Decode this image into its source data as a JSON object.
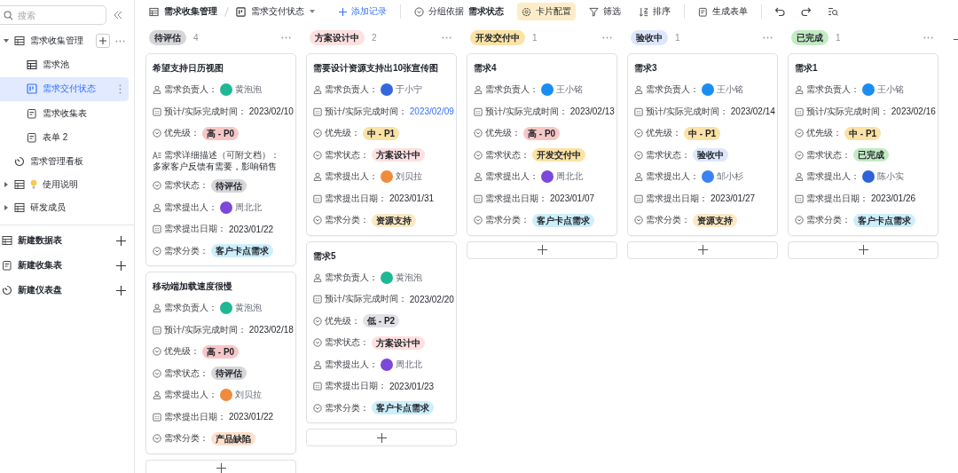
{
  "sidebar": {
    "search": {
      "placeholder": "搜索"
    },
    "tree": [
      {
        "label": "需求收集管理",
        "kind": "table",
        "expanded": true,
        "selected": false,
        "children": [
          {
            "label": "需求池",
            "kind": "grid",
            "selected": false
          },
          {
            "label": "需求交付状态",
            "kind": "kanban",
            "selected": true
          },
          {
            "label": "需求收集表",
            "kind": "form",
            "selected": false
          },
          {
            "label": "表单 2",
            "kind": "form",
            "selected": false
          }
        ]
      },
      {
        "label": "需求管理看板",
        "kind": "dashboard",
        "selected": false
      },
      {
        "label": "使用说明",
        "kind": "table",
        "expanded": false,
        "selected": false,
        "bulb": true
      },
      {
        "label": "研发成员",
        "kind": "table",
        "expanded": false,
        "selected": false
      }
    ],
    "create": [
      {
        "label": "新建数据表",
        "kind": "table"
      },
      {
        "label": "新建收集表",
        "kind": "form"
      },
      {
        "label": "新建仪表盘",
        "kind": "dashboard"
      }
    ]
  },
  "toolbar": {
    "breadcrumb": [
      {
        "label": "需求收集管理",
        "kind": "table"
      },
      {
        "label": "需求交付状态",
        "kind": "kanban"
      }
    ],
    "add_record": "添加记录",
    "group_by": {
      "label": "分组依据",
      "value": "需求状态"
    },
    "actions": [
      {
        "label": "卡片配置",
        "kind": "gear",
        "selected": true
      },
      {
        "label": "筛选",
        "kind": "filter",
        "selected": false
      },
      {
        "label": "排序",
        "kind": "sort",
        "selected": false
      }
    ],
    "generate_form": "生成表单"
  },
  "columns": [
    {
      "label": "待评估",
      "color": "#d6d6d9",
      "count": "4",
      "cards": [
        {
          "title": "希望支持日历视图",
          "fields": [
            {
              "kind": "person",
              "label": "需求负责人：",
              "name": "黄泡泡",
              "color": "#1fb894"
            },
            {
              "kind": "date",
              "label": "预计/实际完成时间：",
              "value": "2023/02/10",
              "highlighted": false
            },
            {
              "kind": "select",
              "label": "优先级：",
              "value": "高 - P0",
              "color": "#f7c7c7"
            },
            {
              "kind": "text",
              "label": "需求详细描述（可附文档）：",
              "value": "多家客户反馈有需要，影响销售"
            },
            {
              "kind": "select",
              "label": "需求状态：",
              "value": "待评估",
              "color": "#d6d6d9"
            },
            {
              "kind": "person",
              "label": "需求提出人：",
              "name": "周北北",
              "color": "#7d48d9"
            },
            {
              "kind": "date",
              "label": "需求提出日期：",
              "value": "2023/01/22",
              "highlighted": false
            },
            {
              "kind": "select",
              "label": "需求分类：",
              "value": "客户卡点需求",
              "color": "#cdeefb"
            }
          ]
        },
        {
          "title": "移动端加载速度很慢",
          "fields": [
            {
              "kind": "person",
              "label": "需求负责人：",
              "name": "黄泡泡",
              "color": "#1fb894"
            },
            {
              "kind": "date",
              "label": "预计/实际完成时间：",
              "value": "2023/02/18",
              "highlighted": false
            },
            {
              "kind": "select",
              "label": "优先级：",
              "value": "高 - P0",
              "color": "#f7c7c7"
            },
            {
              "kind": "select",
              "label": "需求状态：",
              "value": "待评估",
              "color": "#d6d6d9"
            },
            {
              "kind": "person",
              "label": "需求提出人：",
              "name": "刘贝拉",
              "color": "#f08a3c"
            },
            {
              "kind": "date",
              "label": "需求提出日期：",
              "value": "2023/01/22",
              "highlighted": false
            },
            {
              "kind": "select",
              "label": "需求分类：",
              "value": "产品缺陷",
              "color": "#fde0cb"
            }
          ]
        }
      ]
    },
    {
      "label": "方案设计中",
      "color": "#fde0e0",
      "count": "2",
      "cards": [
        {
          "title": "需要设计资源支持出10张宣传图",
          "fields": [
            {
              "kind": "person",
              "label": "需求负责人：",
              "name": "于小宁",
              "color": "#3567dc"
            },
            {
              "kind": "date",
              "label": "预计/实际完成时间：",
              "value": "2023/02/09",
              "highlighted": true
            },
            {
              "kind": "select",
              "label": "优先级：",
              "value": "中 - P1",
              "color": "#fbe2a5"
            },
            {
              "kind": "select",
              "label": "需求状态：",
              "value": "方案设计中",
              "color": "#fde0e0"
            },
            {
              "kind": "person",
              "label": "需求提出人：",
              "name": "刘贝拉",
              "color": "#f08a3c"
            },
            {
              "kind": "date",
              "label": "需求提出日期：",
              "value": "2023/01/31",
              "highlighted": false
            },
            {
              "kind": "select",
              "label": "需求分类：",
              "value": "资源支持",
              "color": "#fbe9c4"
            }
          ]
        },
        {
          "title": "需求5",
          "fields": [
            {
              "kind": "person",
              "label": "需求负责人：",
              "name": "黄泡泡",
              "color": "#1fb894"
            },
            {
              "kind": "date",
              "label": "预计/实际完成时间：",
              "value": "2023/02/20",
              "highlighted": false
            },
            {
              "kind": "select",
              "label": "优先级：",
              "value": "低 - P2",
              "color": "#e2e2e5"
            },
            {
              "kind": "select",
              "label": "需求状态：",
              "value": "方案设计中",
              "color": "#fde0e0"
            },
            {
              "kind": "person",
              "label": "需求提出人：",
              "name": "周北北",
              "color": "#7d48d9"
            },
            {
              "kind": "date",
              "label": "需求提出日期：",
              "value": "2023/01/23",
              "highlighted": false
            },
            {
              "kind": "select",
              "label": "需求分类：",
              "value": "客户卡点需求",
              "color": "#cdeefb"
            }
          ]
        }
      ]
    },
    {
      "label": "开发交付中",
      "color": "#fbe2a5",
      "count": "1",
      "cards": [
        {
          "title": "需求4",
          "fields": [
            {
              "kind": "person",
              "label": "需求负责人：",
              "name": "王小铭",
              "color": "#1a8df0"
            },
            {
              "kind": "date",
              "label": "预计/实际完成时间：",
              "value": "2023/02/13",
              "highlighted": false
            },
            {
              "kind": "select",
              "label": "优先级：",
              "value": "高 - P0",
              "color": "#f7c7c7"
            },
            {
              "kind": "select",
              "label": "需求状态：",
              "value": "开发交付中",
              "color": "#fbe2a5"
            },
            {
              "kind": "person",
              "label": "需求提出人：",
              "name": "周北北",
              "color": "#7d48d9"
            },
            {
              "kind": "date",
              "label": "需求提出日期：",
              "value": "2023/01/07",
              "highlighted": false
            },
            {
              "kind": "select",
              "label": "需求分类：",
              "value": "客户卡点需求",
              "color": "#cdeefb"
            }
          ]
        }
      ]
    },
    {
      "label": "验收中",
      "color": "#dde6fb",
      "count": "1",
      "cards": [
        {
          "title": "需求3",
          "fields": [
            {
              "kind": "person",
              "label": "需求负责人：",
              "name": "王小铭",
              "color": "#1a8df0"
            },
            {
              "kind": "date",
              "label": "预计/实际完成时间：",
              "value": "2023/02/14",
              "highlighted": false
            },
            {
              "kind": "select",
              "label": "优先级：",
              "value": "中 - P1",
              "color": "#fbe2a5"
            },
            {
              "kind": "select",
              "label": "需求状态：",
              "value": "验收中",
              "color": "#dde6fb"
            },
            {
              "kind": "person",
              "label": "需求提出人：",
              "name": "邹小杉",
              "color": "#3b82f6"
            },
            {
              "kind": "date",
              "label": "需求提出日期：",
              "value": "2023/01/27",
              "highlighted": false
            },
            {
              "kind": "select",
              "label": "需求分类：",
              "value": "资源支持",
              "color": "#fbe9c4"
            }
          ]
        }
      ]
    },
    {
      "label": "已完成",
      "color": "#c3ebc3",
      "count": "1",
      "cards": [
        {
          "title": "需求1",
          "fields": [
            {
              "kind": "person",
              "label": "需求负责人：",
              "name": "王小铭",
              "color": "#1a8df0"
            },
            {
              "kind": "date",
              "label": "预计/实际完成时间：",
              "value": "2023/02/16",
              "highlighted": false
            },
            {
              "kind": "select",
              "label": "优先级：",
              "value": "中 - P1",
              "color": "#fbe2a5"
            },
            {
              "kind": "select",
              "label": "需求状态：",
              "value": "已完成",
              "color": "#c3ebc3"
            },
            {
              "kind": "person",
              "label": "需求提出人：",
              "name": "陈小实",
              "color": "#2f62d8"
            },
            {
              "kind": "date",
              "label": "需求提出日期：",
              "value": "2023/01/26",
              "highlighted": false
            },
            {
              "kind": "select",
              "label": "需求分类：",
              "value": "客户卡点需求",
              "color": "#cdeefb"
            }
          ]
        }
      ]
    }
  ]
}
